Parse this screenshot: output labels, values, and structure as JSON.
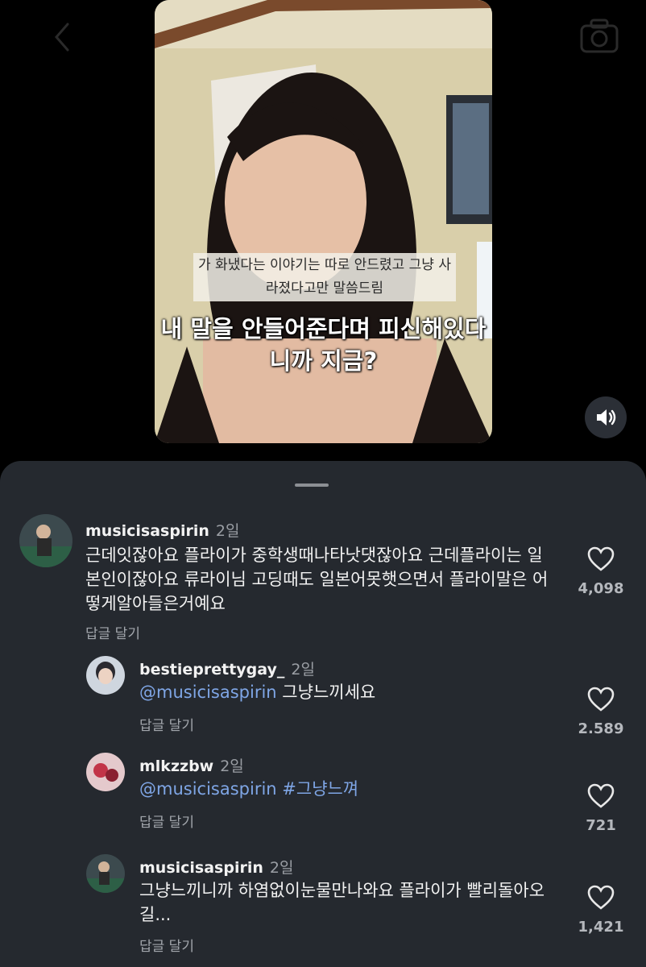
{
  "video": {
    "subtitle_top": "가 화냈다는 이야기는 따로 안드렸고 그냥 사라졌다고만 말씀드림",
    "subtitle_main": "내 말을 안들어준다며 피신해있다니까 지금?"
  },
  "icons": {
    "back": "chevron-left-icon",
    "camera": "camera-icon",
    "sound": "speaker-icon",
    "like": "heart-outline-icon"
  },
  "colors": {
    "sheet_bg": "#25292f",
    "mention": "#7fa6e6"
  },
  "comments": [
    {
      "username": "musicisaspirin",
      "time": "2일",
      "text": "근데잇잖아요 플라이가 중학생때나타낫댓잖아요 근데플라이는 일본인이잖아요 류라이님 고딩때도 일본어못햇으면서 플라이말은 어떻게알아들은거예요",
      "reply_label": "답글 달기",
      "likes": "4,098"
    }
  ],
  "replies": [
    {
      "username": "bestieprettygay_",
      "time": "2일",
      "mention": "@musicisaspirin",
      "text": " 그냥느끼세요",
      "reply_label": "답글 달기",
      "likes": "2.589"
    },
    {
      "username": "mlkzzbw",
      "time": "2일",
      "mention": "@musicisaspirin #그냥느껴",
      "text": "",
      "reply_label": "답글 달기",
      "likes": "721"
    },
    {
      "username": "musicisaspirin",
      "time": "2일",
      "mention": "",
      "text": "그냥느끼니까 하염없이눈물만나와요 플라이가 빨리돌아오길...",
      "reply_label": "답글 달기",
      "likes": "1,421"
    }
  ]
}
